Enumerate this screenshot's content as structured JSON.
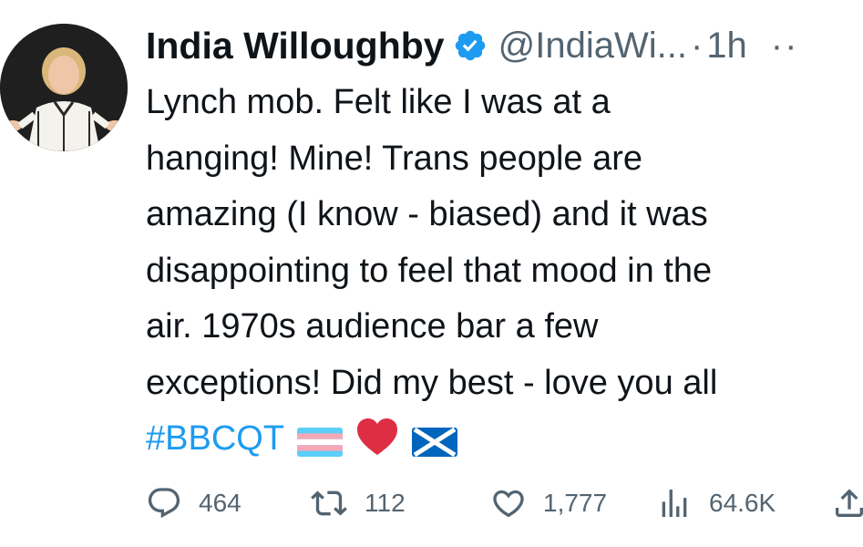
{
  "tweet": {
    "display_name": "India Willoughby",
    "handle": "@IndiaWi...",
    "separator": "·",
    "time": "1h",
    "more": "··",
    "verified_icon": "verified-badge-icon",
    "text_lines": [
      "Lynch mob. Felt like I was at a",
      "hanging! Mine! Trans people are",
      "amazing (I know - biased) and it was",
      "disappointing to feel that mood in the",
      "air. 1970s audience bar a few",
      "exceptions! Did my best - love you all"
    ],
    "hashtag": "#BBCQT",
    "emojis": [
      "transgender-flag-icon",
      "red-heart-icon",
      "scotland-flag-icon"
    ]
  },
  "actions": {
    "replies": "464",
    "retweets": "112",
    "likes": "1,777",
    "views": "64.6K",
    "icons": [
      "reply-icon",
      "retweet-icon",
      "like-icon",
      "views-icon",
      "share-icon"
    ]
  },
  "colors": {
    "accent": "#1d9bf0",
    "text": "#0f1419",
    "secondary": "#536471"
  }
}
